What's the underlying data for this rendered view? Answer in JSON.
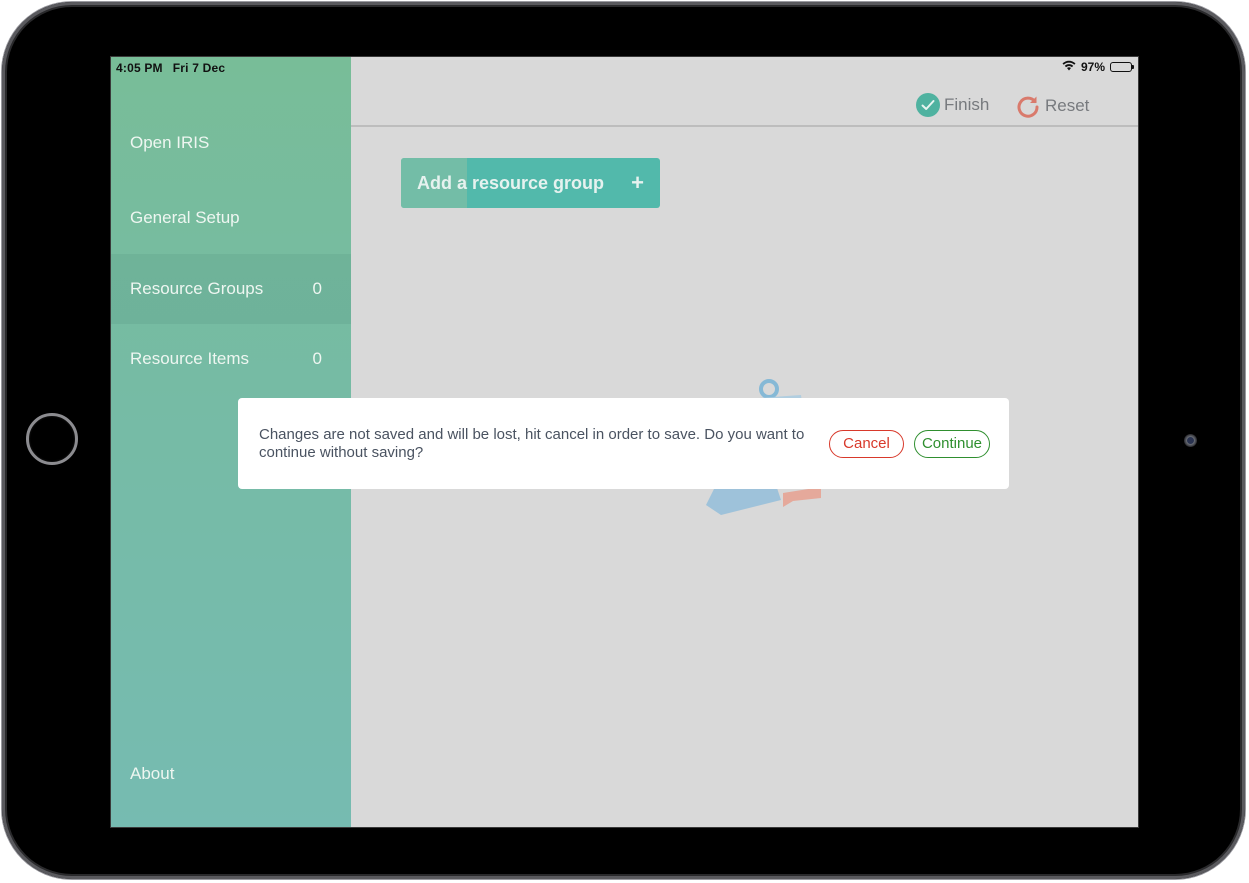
{
  "status_bar": {
    "time": "4:05 PM",
    "date": "Fri 7 Dec",
    "battery_percent_label": "97%",
    "battery_level": 0.97,
    "wifi_icon": "wifi-icon",
    "battery_icon": "battery-icon"
  },
  "sidebar": {
    "items": [
      {
        "label": "Open IRIS",
        "count": null,
        "active": false
      },
      {
        "label": "General Setup",
        "count": null,
        "active": false
      },
      {
        "label": "Resource Groups",
        "count": "0",
        "active": true
      },
      {
        "label": "Resource Items",
        "count": "0",
        "active": false
      }
    ],
    "footer_item": {
      "label": "About"
    }
  },
  "header": {
    "finish_label": "Finish",
    "finish_icon": "check-circle-icon",
    "reset_label": "Reset",
    "reset_icon": "refresh-icon"
  },
  "main": {
    "add_group_label": "Add a resource group",
    "add_group_icon": "+",
    "empty_state_icon": "clipboard-illustration"
  },
  "dialog": {
    "message": "Changes are not saved and will be lost, hit cancel in order to save. Do you want to continue without saving?",
    "cancel_label": "Cancel",
    "continue_label": "Continue"
  },
  "colors": {
    "sidebar_top": "#78bd98",
    "sidebar_bottom": "#76bbb1",
    "accent_teal": "#52b9ab",
    "cancel_red": "#d8392b",
    "continue_green": "#2f8f2f",
    "reset_icon_color": "#d97a6c",
    "background": "#d9d9d9"
  }
}
